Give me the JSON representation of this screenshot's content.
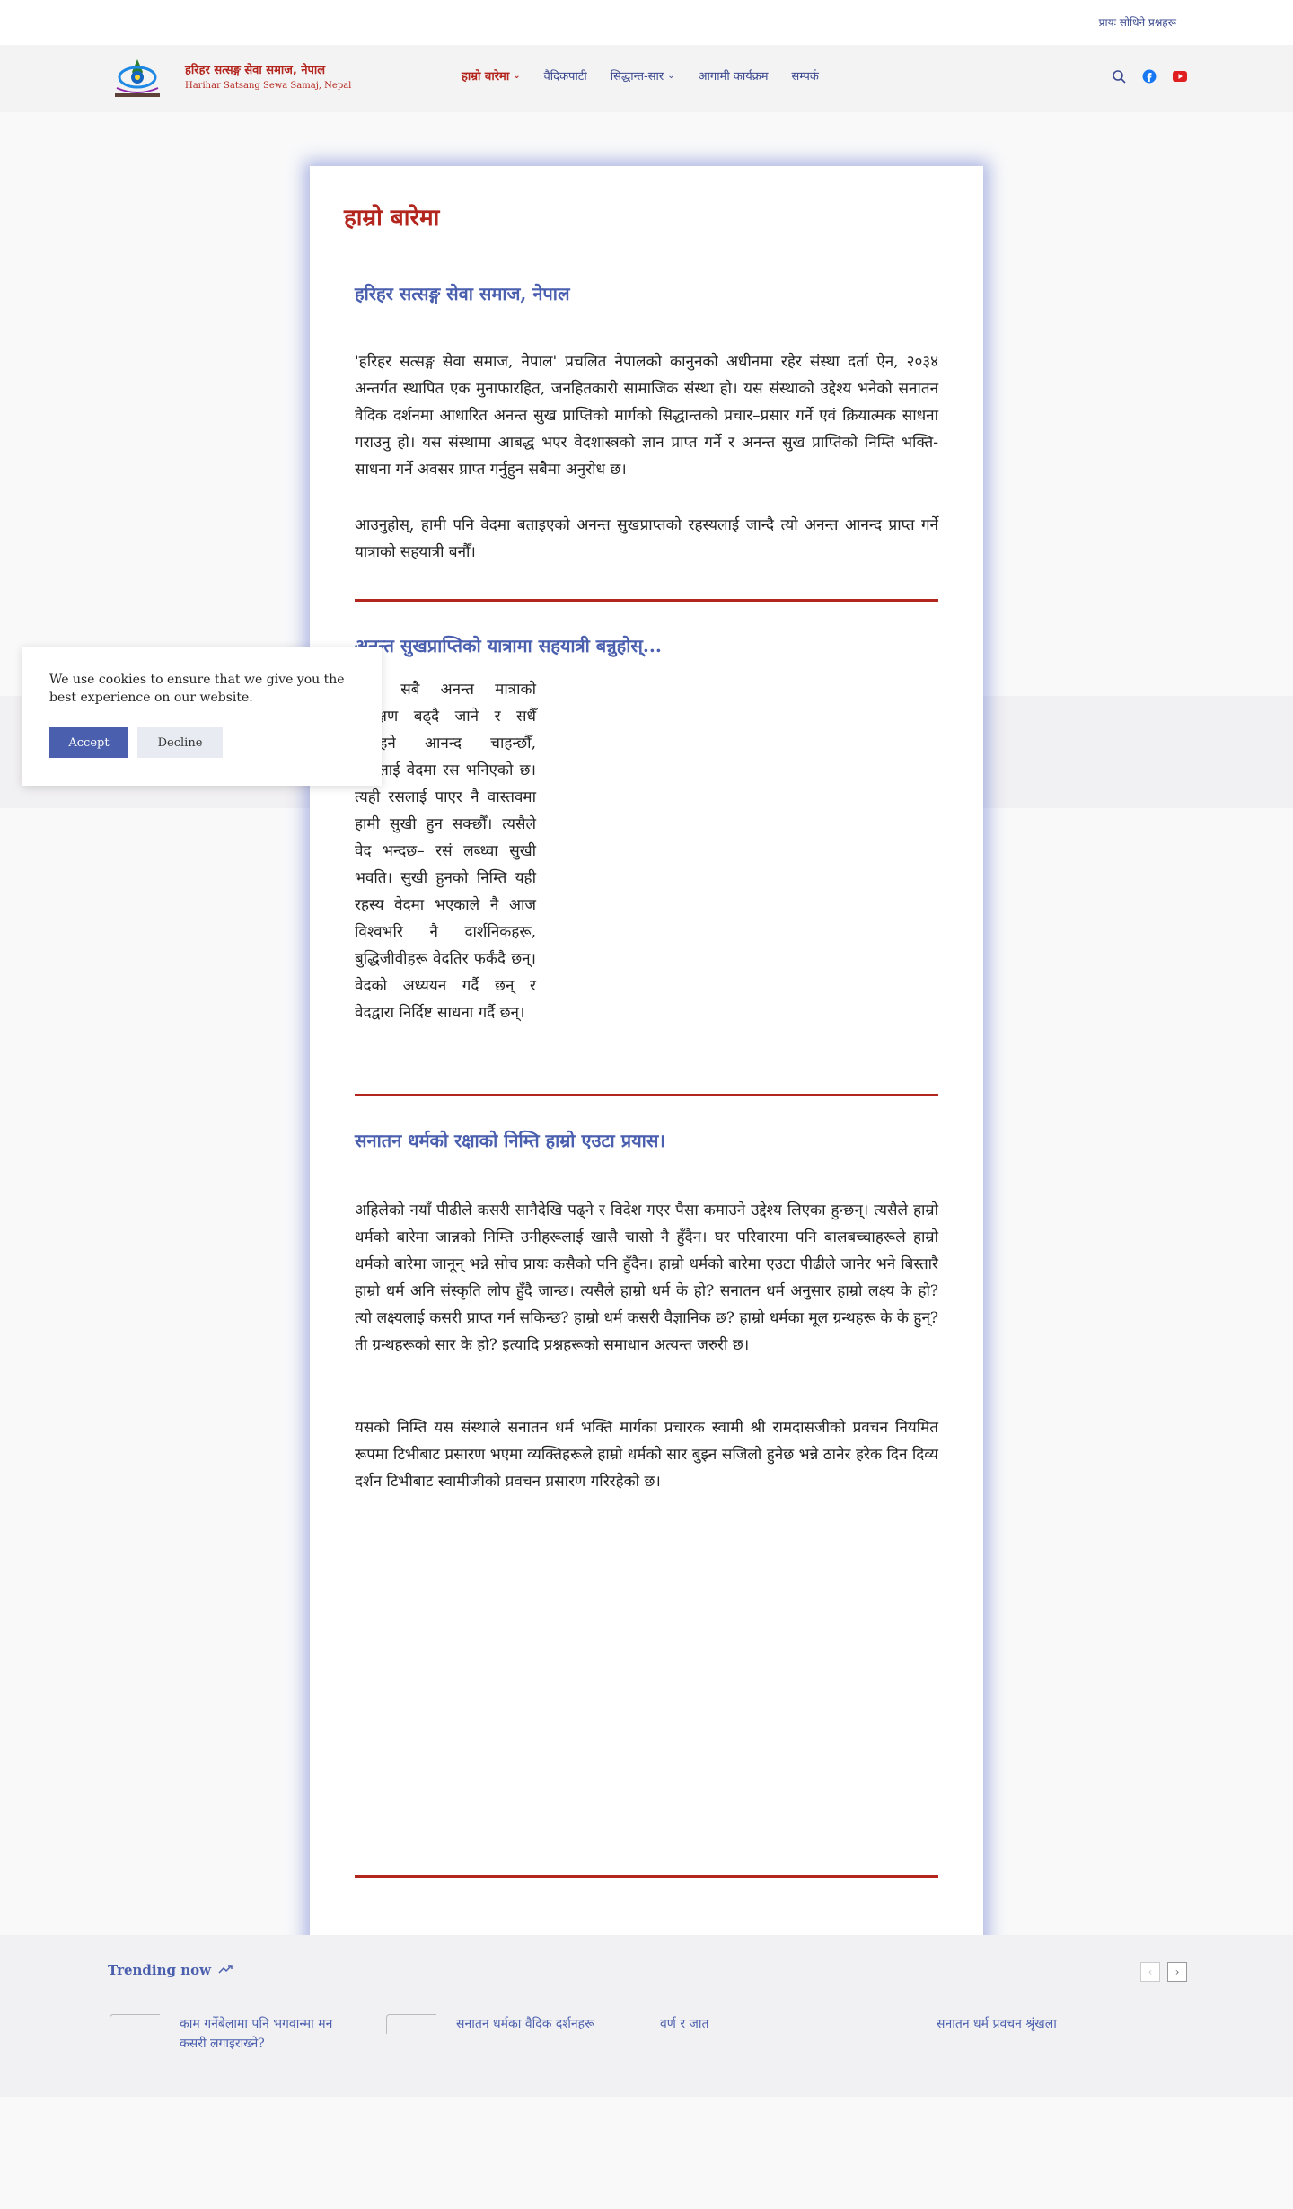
{
  "topbar": {
    "faq_label": "प्रायः सोधिने प्रश्नहरू"
  },
  "header": {
    "brand_title": "हरिहर सत्सङ्ग सेवा समाज, नेपाल",
    "brand_sub": "Harihar Satsang Sewa Samaj, Nepal",
    "nav": [
      {
        "label": "हाम्रो बारेमा",
        "chevron": true
      },
      {
        "label": "वैदिकपाटी",
        "chevron": false
      },
      {
        "label": "सिद्धान्त-सार",
        "chevron": true
      },
      {
        "label": "आगामी कार्यक्रम",
        "chevron": false
      },
      {
        "label": "सम्पर्क",
        "chevron": false
      }
    ],
    "icons": [
      "search-icon",
      "facebook-icon",
      "youtube-icon"
    ],
    "colors": {
      "brand_red": "#b3261e",
      "nav_blue": "#3b4a8f",
      "youtube_red": "#e02020",
      "facebook_blue": "#1877f2"
    }
  },
  "article": {
    "title": "हाम्रो बारेमा",
    "section1_heading": "हरिहर सत्सङ्ग सेवा समाज, नेपाल",
    "section1_p1": "'हरिहर सत्सङ्ग सेवा समाज, नेपाल' प्रचलित नेपालको कानुनको अधीनमा रहेर संस्था दर्ता ऐन, २०३४ अन्तर्गत स्थापित एक मुनाफारहित, जनहितकारी सामाजिक संस्था हो। यस संस्थाको उद्देश्य भनेको सनातन वैदिक दर्शनमा आधारित अनन्त सुख प्राप्तिको मार्गको सिद्धान्तको प्रचार–प्रसार गर्ने एवं क्रियात्मक साधना गराउनु हो। यस संस्थामा आबद्ध भएर वेदशास्त्रको ज्ञान प्राप्त गर्ने र अनन्त सुख प्राप्तिको निम्ति भक्ति-साधना गर्ने अवसर प्राप्त गर्नुहुन सबैमा अनुरोध छ।",
    "section1_p2": "आउनुहोस्, हामी पनि वेदमा बताइएको अनन्त सुखप्राप्तको रहस्यलाई जान्दै त्यो अनन्त आनन्द प्राप्त गर्ने यात्राको सहयात्री बनौँ।",
    "section2_heading": "अनन्त सुखप्राप्तिको यात्रामा सहयात्री बन्नुहोस्...",
    "section2_p": "हामी सबै अनन्त मात्राको प्रतिक्षण बढ्दै जाने र सधैँ रहिरहने आनन्द चाहन्छौँ, त्यसलाई वेदमा रस भनिएको छ। त्यही रसलाई पाएर नै वास्तवमा हामी सुखी हुन सक्छौँ। त्यसैले वेद भन्दछ– रसं लब्ध्वा सुखी भवति। सुखी हुनको निम्ति यही रहस्य वेदमा भएकाले नै आज विश्वभरि नै दार्शनिकहरू, बुद्धिजीवीहरू वेदतिर फर्कंदै छन्। वेदको अध्ययन गर्दै छन् र वेदद्वारा निर्दिष्ट साधना गर्दै छन्।",
    "section3_heading": "सनातन धर्मको रक्षाको निम्ति हाम्रो एउटा प्रयास।",
    "section3_p1": "अहिलेको नयाँ पीढीले कसरी सानैदेखि पढ्ने र विदेश गएर पैसा कमाउने उद्देश्य लिएका हुन्छन्। त्यसैले हाम्रो धर्मको बारेमा जान्नको निम्ति उनीहरूलाई खासै चासो नै हुँदैन। घर परिवारमा पनि बालबच्चाहरूले हाम्रो धर्मको बारेमा जानून् भन्ने सोच प्रायः कसैको पनि हुँदैन। हाम्रो धर्मको बारेमा एउटा पीढीले जानेर भने बिस्तारै हाम्रो धर्म अनि संस्कृति लोप हुँदै जान्छ। त्यसैले हाम्रो धर्म के हो? सनातन धर्म अनुसार हाम्रो लक्ष्य के हो? त्यो लक्ष्यलाई कसरी प्राप्त गर्न सकिन्छ? हाम्रो धर्म कसरी वैज्ञानिक छ? हाम्रो धर्मका मूल ग्रन्थहरू के के हुन्? ती ग्रन्थहरूको सार के हो? इत्यादि प्रश्नहरूको समाधान अत्यन्त जरुरी छ।",
    "section3_p2": "यसको निम्ति यस संस्थाले सनातन धर्म भक्ति मार्गका प्रचारक स्वामी श्री रामदासजीको प्रवचन नियमित रूपमा टिभीबाट प्रसारण भएमा व्यक्तिहरूले हाम्रो धर्मको सार बुझ्न सजिलो हुनेछ भन्ने ठानेर हरेक दिन दिव्य दर्शन टिभीबाट स्वामीजीको प्रवचन प्रसारण गरिरहेको छ।"
  },
  "cookie": {
    "message": "We use cookies to ensure that we give you the best experience on our website.",
    "accept_label": "Accept",
    "decline_label": "Decline"
  },
  "trending": {
    "label": "Trending now",
    "items": [
      "काम गर्नेबेलामा पनि भगवान्मा मन कसरी लगाइराख्ने?",
      "सनातन धर्मका वैदिक दर्शनहरू",
      "वर्ण र जात",
      "सनातन धर्म प्रवचन श्रृंखला"
    ]
  }
}
